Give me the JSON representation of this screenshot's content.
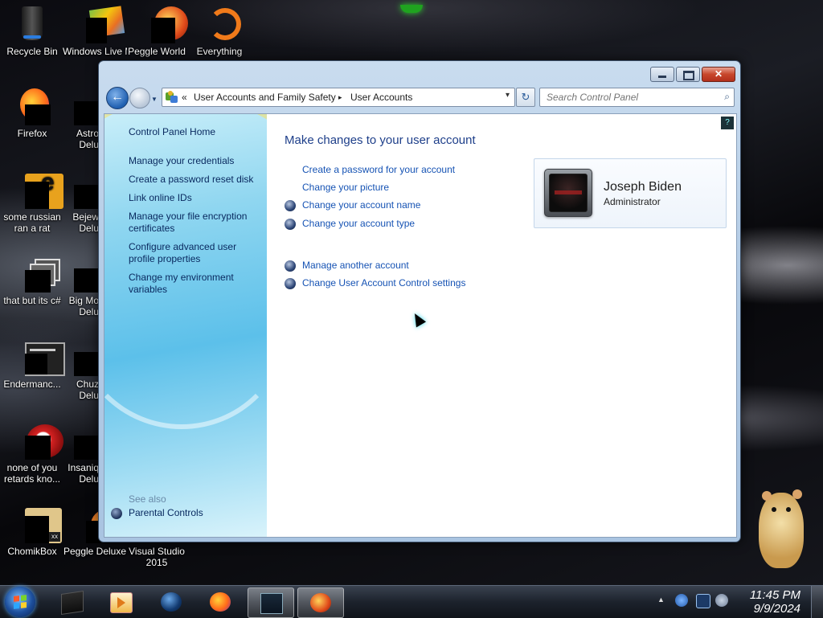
{
  "desktop": {
    "icons": [
      {
        "label": "Recycle Bin"
      },
      {
        "label": "Windows Live Ma"
      },
      {
        "label": "Peggle World"
      },
      {
        "label": "Everything"
      },
      {
        "label": "Firefox"
      },
      {
        "label": "Astro Delu"
      },
      {
        "label": "some russian ran a rat"
      },
      {
        "label": "Bejew Delu"
      },
      {
        "label": "that but its c#"
      },
      {
        "label": "Big Mo Delu"
      },
      {
        "label": "Endermanc..."
      },
      {
        "label": "Chuz Delu"
      },
      {
        "label": "none of you retards kno..."
      },
      {
        "label": "Insaniq Delu"
      },
      {
        "label": "ChomikBox"
      },
      {
        "label": "Peggle Deluxe"
      },
      {
        "label": "Visual Studio 2015"
      }
    ]
  },
  "window": {
    "caption_buttons": {
      "minimize": "",
      "maximize": "",
      "close": "✕"
    },
    "nav": {
      "back_glyph": "←",
      "address_chevron": "«",
      "breadcrumb": [
        "User Accounts and Family Safety",
        "User Accounts"
      ],
      "separator": "▸",
      "dropdown_glyph": "▾",
      "refresh_glyph": "↻",
      "search_placeholder": "Search Control Panel",
      "search_glyph": "⌕"
    },
    "left_pane": {
      "home": "Control Panel Home",
      "links": [
        "Manage your credentials",
        "Create a password reset disk",
        "Link online IDs",
        "Manage your file encryption certificates",
        "Configure advanced user profile properties",
        "Change my environment variables"
      ],
      "see_also_label": "See also",
      "see_also_links": [
        "Parental Controls"
      ]
    },
    "main": {
      "heading": "Make changes to your user account",
      "help_glyph": "?",
      "tasks": [
        {
          "label": "Create a password for your account",
          "shield": false
        },
        {
          "label": "Change your picture",
          "shield": false
        },
        {
          "label": "Change your account name",
          "shield": true
        },
        {
          "label": "Change your account type",
          "shield": true
        }
      ],
      "other_tasks": [
        {
          "label": "Manage another account",
          "shield": true
        },
        {
          "label": "Change User Account Control settings",
          "shield": true
        }
      ],
      "user_card": {
        "name": "Joseph Biden",
        "role": "Administrator"
      }
    }
  },
  "taskbar": {
    "start_icon": "windows-orb",
    "pinned": [
      "explorer",
      "media-player",
      "globe-app",
      "firefox",
      "control-panel",
      "peggle"
    ],
    "active_index": 4,
    "tray_up_glyph": "▲",
    "clock": {
      "time": "11:45 PM",
      "date": "9/9/2024"
    }
  },
  "colors": {
    "link": "#1653b4",
    "heading": "#1e3f8a",
    "nav_link": "#0a2a60"
  }
}
